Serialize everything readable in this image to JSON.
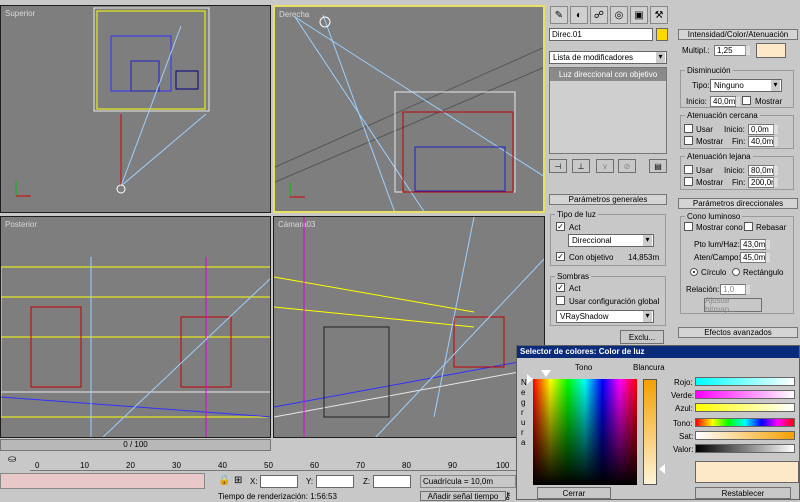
{
  "viewports": {
    "top_left": {
      "label": "Superior"
    },
    "top_right": {
      "label": "Derecha"
    },
    "bottom_left": {
      "label": "Posterior"
    },
    "bottom_right": {
      "label": "Cámara03"
    }
  },
  "command_panel": {
    "object_name": "Direc.01",
    "modifier_list": "Lista de modificadores",
    "stack_item": "Luz direccional con objetivo",
    "rollout_general": "Parámetros generales",
    "light_type_group": "Tipo de luz",
    "act_label": "Act",
    "light_type_value": "Direccional",
    "target_label": "Con objetivo",
    "target_distance": "14,853m",
    "shadows_group": "Sombras",
    "shadows_act_label": "Act",
    "global_settings_label": "Usar configuración global",
    "shadow_type": "VRayShadow",
    "exclude_button": "Exclu..."
  },
  "right_panel": {
    "rollout_intensity": "Intensidad/Color/Atenuación",
    "multiplier_label": "Multipl.:",
    "multiplier_value": "1,25",
    "decay_group": "Disminución",
    "type_label": "Tipo:",
    "type_value": "Ninguno",
    "start_label": "Inicio:",
    "start_value": "40,0m",
    "show_label": "Mostrar",
    "near_group": "Atenuación cercana",
    "use_label": "Usar",
    "near_start_label": "Inicio:",
    "near_start_value": "0,0m",
    "near_show_label": "Mostrar",
    "near_end_label": "Fin:",
    "near_end_value": "40,0m",
    "far_group": "Atenuación lejana",
    "far_use_label": "Usar",
    "far_start_label": "Inicio:",
    "far_start_value": "80,0m",
    "far_show_label": "Mostrar",
    "far_end_label": "Fin:",
    "far_end_value": "200,0m",
    "rollout_directional": "Parámetros direccionales",
    "cone_group": "Cono luminoso",
    "show_cone_label": "Mostrar cono",
    "overshoot_label": "Rebasar",
    "hotspot_label": "Pto lum/Haz:",
    "hotspot_value": "43,0m",
    "falloff_label": "Aten/Campo:",
    "falloff_value": "45,0m",
    "circle_label": "Círculo",
    "rectangle_label": "Rectángulo",
    "aspect_label": "Relación:",
    "aspect_value": "1,0",
    "bitmap_button": "Ajustar bitmap...",
    "rollout_advanced": "Efectos avanzados"
  },
  "color_picker": {
    "title": "Selector de colores: Color de luz",
    "hue_label": "Tono",
    "whiteness_label": "Blancura",
    "blackness_label": "Negrura",
    "red_label": "Rojo:",
    "green_label": "Verde:",
    "blue_label": "Azul:",
    "hue2_label": "Tono:",
    "sat_label": "Sat:",
    "value_label": "Valor:",
    "close_button": "Cerrar",
    "reset_button": "Restablecer",
    "color_hex": "#fde9c8"
  },
  "timeline": {
    "frame_counter": "0 / 100",
    "ticks": [
      "0",
      "10",
      "20",
      "30",
      "40",
      "50",
      "60",
      "70",
      "80",
      "90",
      "100"
    ],
    "x_label": "X:",
    "y_label": "Y:",
    "z_label": "Z:",
    "grid": "Cuadrícula = 10,0m",
    "render_time": "Tiempo de renderización: 1:56:53",
    "add_time_tag": "Añadir señal tiempo"
  }
}
